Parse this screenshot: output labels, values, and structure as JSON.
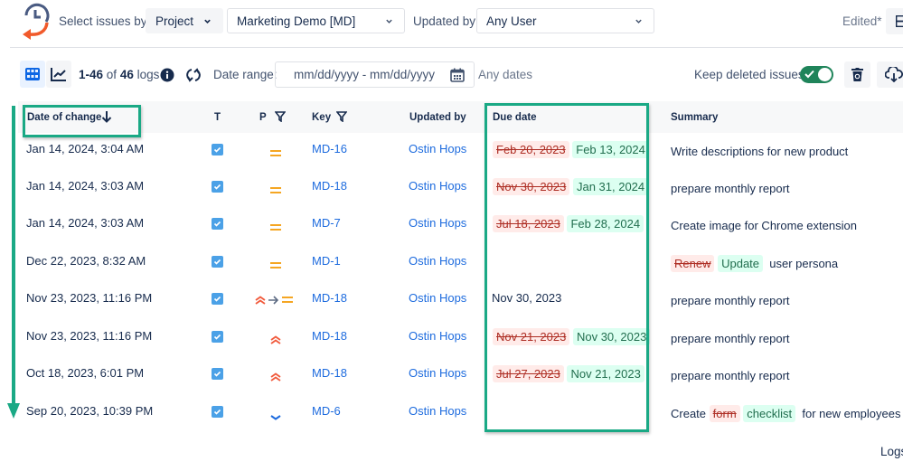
{
  "header": {
    "select_issues_label": "Select issues by:",
    "select_type_value": "Project",
    "project_value": "Marketing Demo [MD]",
    "updated_by_label": "Updated by:",
    "updated_by_value": "Any User",
    "edited_label": "Edited*"
  },
  "toolbar": {
    "count_range": "1-46",
    "count_of": "of",
    "count_total": "46",
    "count_unit": "logs",
    "date_range_label": "Date range:",
    "date_range_placeholder": "mm/dd/yyyy - mm/dd/yyyy",
    "any_dates_label": "Any dates",
    "keep_deleted_label": "Keep deleted issues",
    "keep_deleted_on": true
  },
  "table": {
    "columns": {
      "date": "Date of change",
      "type": "T",
      "priority": "P",
      "key": "Key",
      "updated_by": "Updated by",
      "due_date": "Due date",
      "summary": "Summary"
    },
    "rows": [
      {
        "date": "Jan 14, 2024, 3:04 AM",
        "priority": "medium",
        "key": "MD-16",
        "updated_by": "Ostin Hops",
        "due_old": "Feb 20, 2023",
        "due_new": "Feb 13, 2024",
        "summary": "Write descriptions for new product"
      },
      {
        "date": "Jan 14, 2024, 3:03 AM",
        "priority": "medium",
        "key": "MD-18",
        "updated_by": "Ostin Hops",
        "due_old": "Nov 30, 2023",
        "due_new": "Jan 31, 2024",
        "summary": "prepare monthly report"
      },
      {
        "date": "Jan 14, 2024, 3:03 AM",
        "priority": "medium",
        "key": "MD-7",
        "updated_by": "Ostin Hops",
        "due_old": "Jul 18, 2023",
        "due_new": "Feb 28, 2024",
        "summary": "Create image for Chrome extension"
      },
      {
        "date": "Dec 22, 2023, 8:32 AM",
        "priority": "medium",
        "key": "MD-1",
        "updated_by": "Ostin Hops",
        "summary_old": "Renew",
        "summary_new": "Update",
        "summary_rest": "user persona"
      },
      {
        "date": "Nov 23, 2023, 11:16 PM",
        "priority": "high-to-medium",
        "key": "MD-18",
        "updated_by": "Ostin Hops",
        "due_plain": "Nov 30, 2023",
        "summary": "prepare monthly report"
      },
      {
        "date": "Nov 23, 2023, 11:16 PM",
        "priority": "high",
        "key": "MD-18",
        "updated_by": "Ostin Hops",
        "due_old": "Nov 21, 2023",
        "due_new": "Nov 30, 2023",
        "summary": "prepare monthly report"
      },
      {
        "date": "Oct 18, 2023, 6:01 PM",
        "priority": "high",
        "key": "MD-18",
        "updated_by": "Ostin Hops",
        "due_old": "Jul 27, 2023",
        "due_new": "Nov 21, 2023",
        "summary": "prepare monthly report"
      },
      {
        "date": "Sep 20, 2023, 10:39 PM",
        "priority": "low",
        "key": "MD-6",
        "updated_by": "Ostin Hops",
        "summary_pre": "Create",
        "summary_old": "form",
        "summary_new": "checklist",
        "summary_rest": "for new employees"
      }
    ]
  },
  "footer": {
    "logs_label": "Logs"
  },
  "colors": {
    "highlight": "#1aa985",
    "link": "#1d6bde",
    "priority_medium": "#f5a623",
    "priority_high": "#f15a3c",
    "priority_low": "#1d6bde",
    "toggle_on": "#1f845a"
  }
}
